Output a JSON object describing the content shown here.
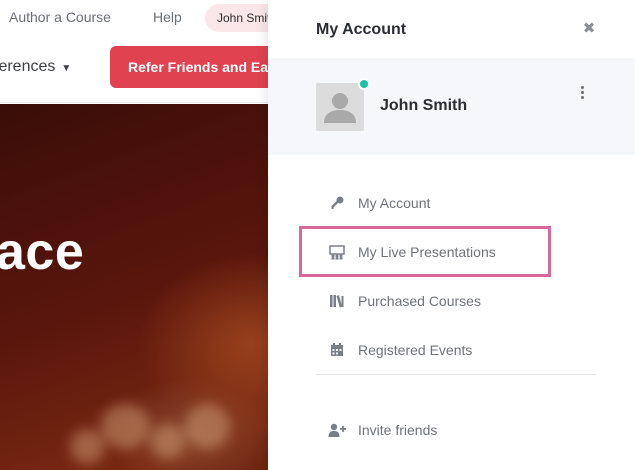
{
  "background": {
    "nav": {
      "author_label": "Author a Course",
      "help_label": "Help",
      "user_label": "John Smith"
    },
    "subnav": {
      "conferences_label": "ferences",
      "refer_label": "Refer Friends and Ea"
    },
    "hero": {
      "headline": "ace"
    }
  },
  "drawer": {
    "title": "My Account",
    "close_icon": "close-icon",
    "profile": {
      "name": "John Smith",
      "status_color": "#19c4a0"
    },
    "menu": [
      {
        "label": "My Account",
        "icon": "key-icon"
      },
      {
        "label": "My Live Presentations",
        "icon": "presentation-icon"
      },
      {
        "label": "Purchased Courses",
        "icon": "books-icon"
      },
      {
        "label": "Registered Events",
        "icon": "calendar-icon"
      }
    ],
    "secondary_menu": [
      {
        "label": "Invite friends",
        "icon": "add-user-icon"
      }
    ],
    "highlight_color": "#d9679a"
  },
  "colors": {
    "accent_button": "#e0424f",
    "pill_bg": "#fbe7ea"
  }
}
